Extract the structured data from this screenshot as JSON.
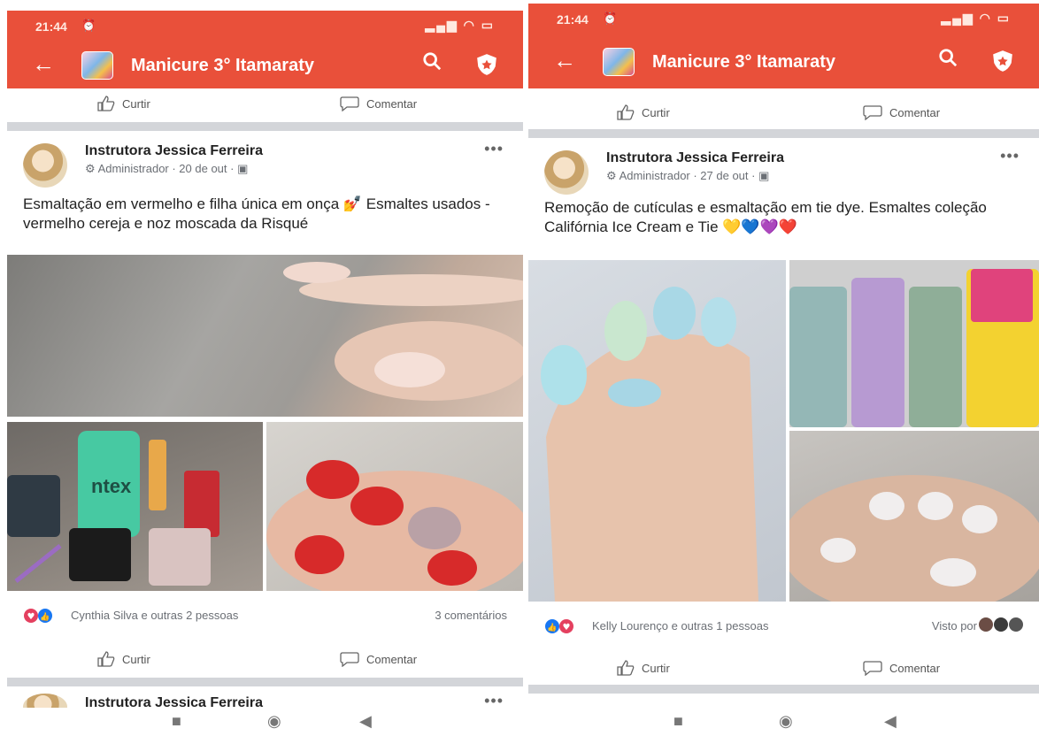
{
  "left": {
    "status_time": "21:44",
    "group_title": "Manicure 3° Itamaraty",
    "top_like_label": "Curtir",
    "top_comment_label": "Comentar",
    "post": {
      "author": "Instrutora Jessica Ferreira",
      "meta": "Administrador · 20 de out ·",
      "text": "Esmaltação em vermelho e filha única em onça 💅 Esmaltes usados - vermelho cereja e noz moscada da Risqué"
    },
    "reactions_text": "Cynthia Silva e outras 2 pessoas",
    "comments_count": "3 comentários",
    "like_label": "Curtir",
    "comment_label": "Comentar",
    "next_author": "Instrutora Jessica Ferreira"
  },
  "right": {
    "status_time": "21:44",
    "group_title": "Manicure 3° Itamaraty",
    "top_like_label": "Curtir",
    "top_comment_label": "Comentar",
    "post": {
      "author": "Instrutora Jessica Ferreira",
      "meta": "Administrador · 27 de out ·",
      "text": "Remoção de cutículas e esmaltação em tie dye. Esmaltes coleção Califórnia Ice Cream e Tie 💛💙💜❤️"
    },
    "reactions_text": "Kelly Lourenço e outras 1 pessoas",
    "seen_by": "Visto por",
    "like_label": "Curtir",
    "comment_label": "Comentar"
  },
  "icons": [
    "back-arrow-icon",
    "search-icon",
    "shield-icon",
    "like-icon",
    "comment-icon",
    "more-icon",
    "love-reaction-icon",
    "like-reaction-icon",
    "recent-apps-icon",
    "home-icon",
    "back-nav-icon"
  ],
  "colors": {
    "appbar": "#e9503a",
    "divider": "#d3d5d9",
    "like_blue": "#1877f2",
    "love_red": "#e4405f"
  }
}
